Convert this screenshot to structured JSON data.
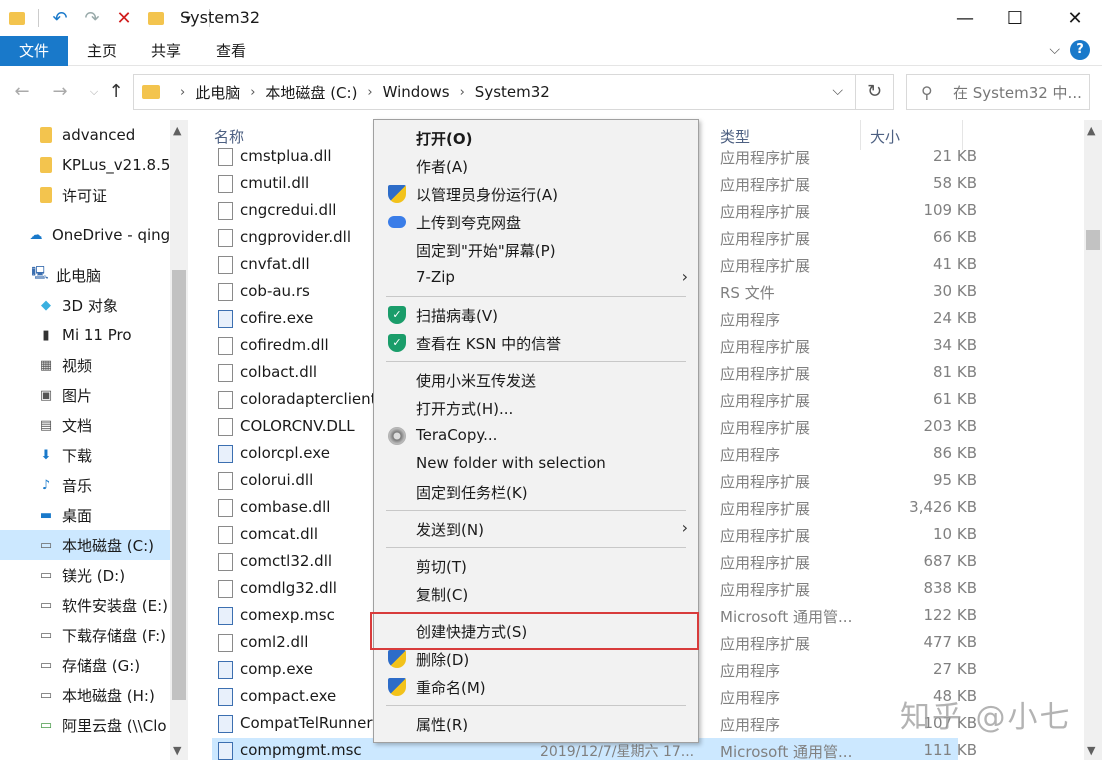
{
  "window": {
    "title": "System32",
    "minimize": "—",
    "maximize": "☐",
    "close": "✕"
  },
  "ribbon": {
    "tabs": [
      "文件",
      "主页",
      "共享",
      "查看"
    ],
    "expand": "⌵",
    "help": "?"
  },
  "address": {
    "crumbs": [
      "此电脑",
      "本地磁盘 (C:)",
      "Windows",
      "System32"
    ],
    "search_placeholder": "在 System32 中..."
  },
  "nav": [
    {
      "label": "advanced",
      "icon": "folder-icon"
    },
    {
      "label": "KPLus_v21.8.5",
      "icon": "folder-icon"
    },
    {
      "label": "许可证",
      "icon": "folder-icon"
    },
    {
      "label": "OneDrive - qing",
      "icon": "cloud-icon"
    },
    {
      "label": "此电脑",
      "icon": "computer-icon"
    },
    {
      "label": "3D 对象",
      "icon": "cube-icon"
    },
    {
      "label": "Mi 11 Pro",
      "icon": "phone-icon"
    },
    {
      "label": "视频",
      "icon": "video-icon"
    },
    {
      "label": "图片",
      "icon": "picture-icon"
    },
    {
      "label": "文档",
      "icon": "document-icon"
    },
    {
      "label": "下载",
      "icon": "download-icon"
    },
    {
      "label": "音乐",
      "icon": "music-icon"
    },
    {
      "label": "桌面",
      "icon": "desktop-icon"
    },
    {
      "label": "本地磁盘 (C:)",
      "icon": "drive-icon",
      "selected": true
    },
    {
      "label": "镁光 (D:)",
      "icon": "drive-icon"
    },
    {
      "label": "软件安装盘 (E:)",
      "icon": "drive-icon"
    },
    {
      "label": "下载存储盘 (F:)",
      "icon": "drive-icon"
    },
    {
      "label": "存储盘 (G:)",
      "icon": "drive-icon"
    },
    {
      "label": "本地磁盘 (H:)",
      "icon": "drive-icon"
    },
    {
      "label": "阿里云盘 (\\\\Clo",
      "icon": "network-drive-icon"
    }
  ],
  "columns": {
    "name": "名称",
    "type": "类型",
    "size": "大小"
  },
  "files": [
    {
      "name": "cmstplua.dll",
      "type": "应用程序扩展",
      "size": "21 KB"
    },
    {
      "name": "cmutil.dll",
      "type": "应用程序扩展",
      "size": "58 KB"
    },
    {
      "name": "cngcredui.dll",
      "type": "应用程序扩展",
      "size": "109 KB"
    },
    {
      "name": "cngprovider.dll",
      "type": "应用程序扩展",
      "size": "66 KB"
    },
    {
      "name": "cnvfat.dll",
      "type": "应用程序扩展",
      "size": "41 KB"
    },
    {
      "name": "cob-au.rs",
      "type": "RS 文件",
      "size": "30 KB"
    },
    {
      "name": "cofire.exe",
      "type": "应用程序",
      "size": "24 KB"
    },
    {
      "name": "cofiredm.dll",
      "type": "应用程序扩展",
      "size": "34 KB"
    },
    {
      "name": "colbact.dll",
      "type": "应用程序扩展",
      "size": "81 KB"
    },
    {
      "name": "coloradapterclient",
      "type": "应用程序扩展",
      "size": "61 KB"
    },
    {
      "name": "COLORCNV.DLL",
      "type": "应用程序扩展",
      "size": "203 KB"
    },
    {
      "name": "colorcpl.exe",
      "type": "应用程序",
      "size": "86 KB"
    },
    {
      "name": "colorui.dll",
      "type": "应用程序扩展",
      "size": "95 KB"
    },
    {
      "name": "combase.dll",
      "type": "应用程序扩展",
      "size": "3,426 KB"
    },
    {
      "name": "comcat.dll",
      "type": "应用程序扩展",
      "size": "10 KB"
    },
    {
      "name": "comctl32.dll",
      "type": "应用程序扩展",
      "size": "687 KB"
    },
    {
      "name": "comdlg32.dll",
      "type": "应用程序扩展",
      "size": "838 KB"
    },
    {
      "name": "comexp.msc",
      "type": "Microsoft 通用管...",
      "size": "122 KB"
    },
    {
      "name": "coml2.dll",
      "type": "应用程序扩展",
      "size": "477 KB"
    },
    {
      "name": "comp.exe",
      "type": "应用程序",
      "size": "27 KB"
    },
    {
      "name": "compact.exe",
      "type": "应用程序",
      "size": "48 KB"
    },
    {
      "name": "CompatTelRunner",
      "type": "应用程序",
      "size": "107 KB"
    },
    {
      "name": "compmgmt.msc",
      "date": "2019/12/7/星期六 17...",
      "type": "Microsoft 通用管...",
      "size": "111 KB",
      "selected": true
    }
  ],
  "context_menu": [
    {
      "label": "打开(O)",
      "bold": true
    },
    {
      "label": "作者(A)"
    },
    {
      "label": "以管理员身份运行(A)",
      "icon": "uac-shield-icon"
    },
    {
      "label": "上传到夸克网盘",
      "icon": "quark-cloud-icon"
    },
    {
      "label": "固定到\"开始\"屏幕(P)"
    },
    {
      "label": "7-Zip",
      "submenu": true
    },
    {
      "sep": true
    },
    {
      "label": "扫描病毒(V)",
      "icon": "kaspersky-icon"
    },
    {
      "label": "查看在 KSN 中的信誉",
      "icon": "kaspersky-icon"
    },
    {
      "sep": true
    },
    {
      "label": "使用小米互传发送"
    },
    {
      "label": "打开方式(H)..."
    },
    {
      "label": "TeraCopy...",
      "icon": "teracopy-icon"
    },
    {
      "label": "New folder with selection"
    },
    {
      "label": "固定到任务栏(K)"
    },
    {
      "sep": true
    },
    {
      "label": "发送到(N)",
      "submenu": true
    },
    {
      "sep": true
    },
    {
      "label": "剪切(T)"
    },
    {
      "label": "复制(C)"
    },
    {
      "sep": true
    },
    {
      "label": "创建快捷方式(S)",
      "highlighted": true
    },
    {
      "label": "删除(D)",
      "icon": "uac-shield-icon"
    },
    {
      "label": "重命名(M)",
      "icon": "uac-shield-icon"
    },
    {
      "sep": true
    },
    {
      "label": "属性(R)"
    }
  ],
  "watermark": "知乎 @小七",
  "colors": {
    "accent": "#1979ca",
    "selection": "#cce8ff",
    "highlight_box": "#d83b3b"
  }
}
